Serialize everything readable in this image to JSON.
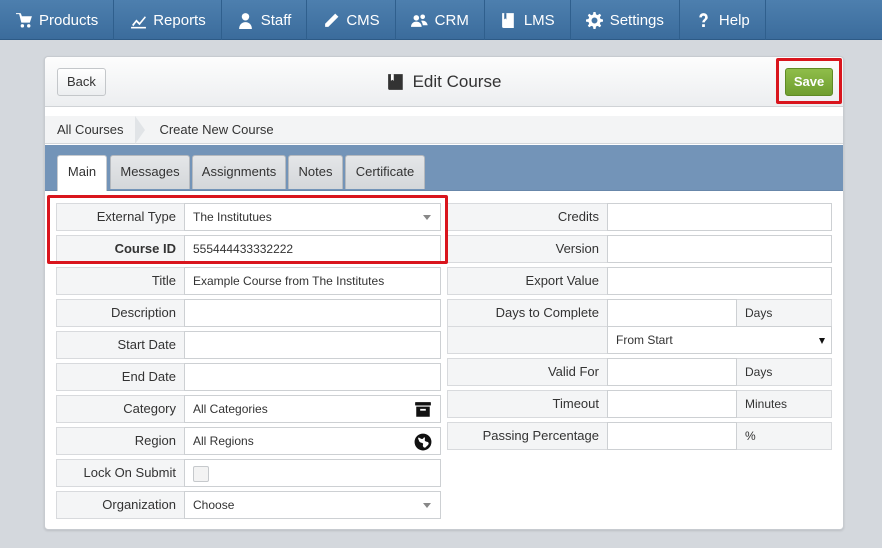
{
  "nav": {
    "items": [
      {
        "label": "Products",
        "icon": "cart-icon"
      },
      {
        "label": "Reports",
        "icon": "chart-icon"
      },
      {
        "label": "Staff",
        "icon": "person-icon"
      },
      {
        "label": "CMS",
        "icon": "pencil-icon"
      },
      {
        "label": "CRM",
        "icon": "people-icon"
      },
      {
        "label": "LMS",
        "icon": "book-icon"
      },
      {
        "label": "Settings",
        "icon": "gear-icon"
      },
      {
        "label": "Help",
        "icon": "question-icon"
      }
    ]
  },
  "header": {
    "back_label": "Back",
    "title": "Edit Course",
    "title_icon": "book-icon",
    "save_label": "Save"
  },
  "breadcrumb": {
    "items": [
      "All Courses",
      "Create New Course"
    ]
  },
  "tabs": [
    {
      "label": "Main",
      "active": true
    },
    {
      "label": "Messages",
      "active": false
    },
    {
      "label": "Assignments",
      "active": false
    },
    {
      "label": "Notes",
      "active": false
    },
    {
      "label": "Certificate",
      "active": false
    }
  ],
  "form_left": {
    "external_type": {
      "label": "External Type",
      "value": "The Institutues"
    },
    "course_id": {
      "label": "Course ID",
      "value": "555444433332222"
    },
    "title": {
      "label": "Title",
      "value": "Example Course from The Institutes"
    },
    "description": {
      "label": "Description",
      "value": ""
    },
    "start_date": {
      "label": "Start Date",
      "value": ""
    },
    "end_date": {
      "label": "End Date",
      "value": ""
    },
    "category": {
      "label": "Category",
      "value": "All Categories",
      "icon": "archive-icon"
    },
    "region": {
      "label": "Region",
      "value": "All Regions",
      "icon": "globe-icon"
    },
    "lock_on_submit": {
      "label": "Lock On Submit",
      "checked": false
    },
    "organization": {
      "label": "Organization",
      "value": "Choose"
    }
  },
  "form_right": {
    "credits": {
      "label": "Credits",
      "value": ""
    },
    "version": {
      "label": "Version",
      "value": ""
    },
    "export_value": {
      "label": "Export Value",
      "value": ""
    },
    "days_to_complete": {
      "label": "Days to Complete",
      "value": "",
      "unit": "Days",
      "from_option": "From Start"
    },
    "valid_for": {
      "label": "Valid For",
      "value": "",
      "unit": "Days"
    },
    "timeout": {
      "label": "Timeout",
      "value": "",
      "unit": "Minutes"
    },
    "passing_percentage": {
      "label": "Passing Percentage",
      "value": "",
      "unit": "%"
    }
  },
  "colors": {
    "nav_bg": "#3b6c9c",
    "tabbar_bg": "#7394b8",
    "save_green": "#7aab37",
    "highlight_red": "#d9151d"
  }
}
